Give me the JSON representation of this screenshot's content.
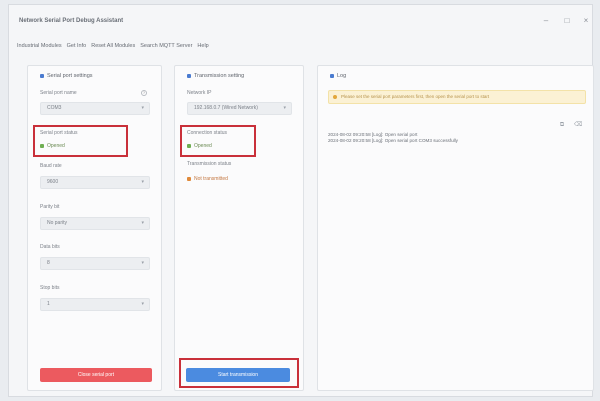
{
  "window": {
    "title": "Network Serial Port Debug Assistant"
  },
  "menu": [
    "Industrial Modules",
    "Get Info",
    "Reset All Modules",
    "Search MQTT Server",
    "Help"
  ],
  "serial_panel": {
    "title": "Serial port settings",
    "serial_port_label": "Serial port name",
    "serial_port_value": "COM3",
    "status_label": "Serial port status",
    "status_value": "Opened",
    "baud_label": "Baud rate",
    "baud_value": "9600",
    "parity_label": "Parity bit",
    "parity_value": "No parity",
    "databits_label": "Data bits",
    "databits_value": "8",
    "stopbits_label": "Stop bits",
    "stopbits_value": "1",
    "close_button": "Close serial port"
  },
  "transmission_panel": {
    "title": "Transmission setting",
    "network_label": "Network IP",
    "network_value": "192.168.0.7 (Wired Network)",
    "conn_label": "Connection status",
    "conn_value": "Opened",
    "trans_label": "Transmission status",
    "trans_value": "Not transmitted",
    "start_button": "Start transmission"
  },
  "log_panel": {
    "title": "Log",
    "notice": "Please set the serial port parameters first, then open the serial port to start",
    "lines": [
      "2024-08-02 09:20:58 [Log]: Open serial port",
      "2024-08-02 09:20:58 [Log]: Open serial port COM3 successfully"
    ]
  },
  "colors": {
    "highlight": "#c9303a",
    "danger_button": "#ec5a5f",
    "primary_button": "#4b8be0",
    "ok_status": "#6fae52",
    "warn_status": "#e08a3a"
  },
  "icons": [
    "minimize-icon",
    "maximize-icon",
    "close-icon",
    "help-icon",
    "copy-icon",
    "clear-icon",
    "warning-icon"
  ]
}
